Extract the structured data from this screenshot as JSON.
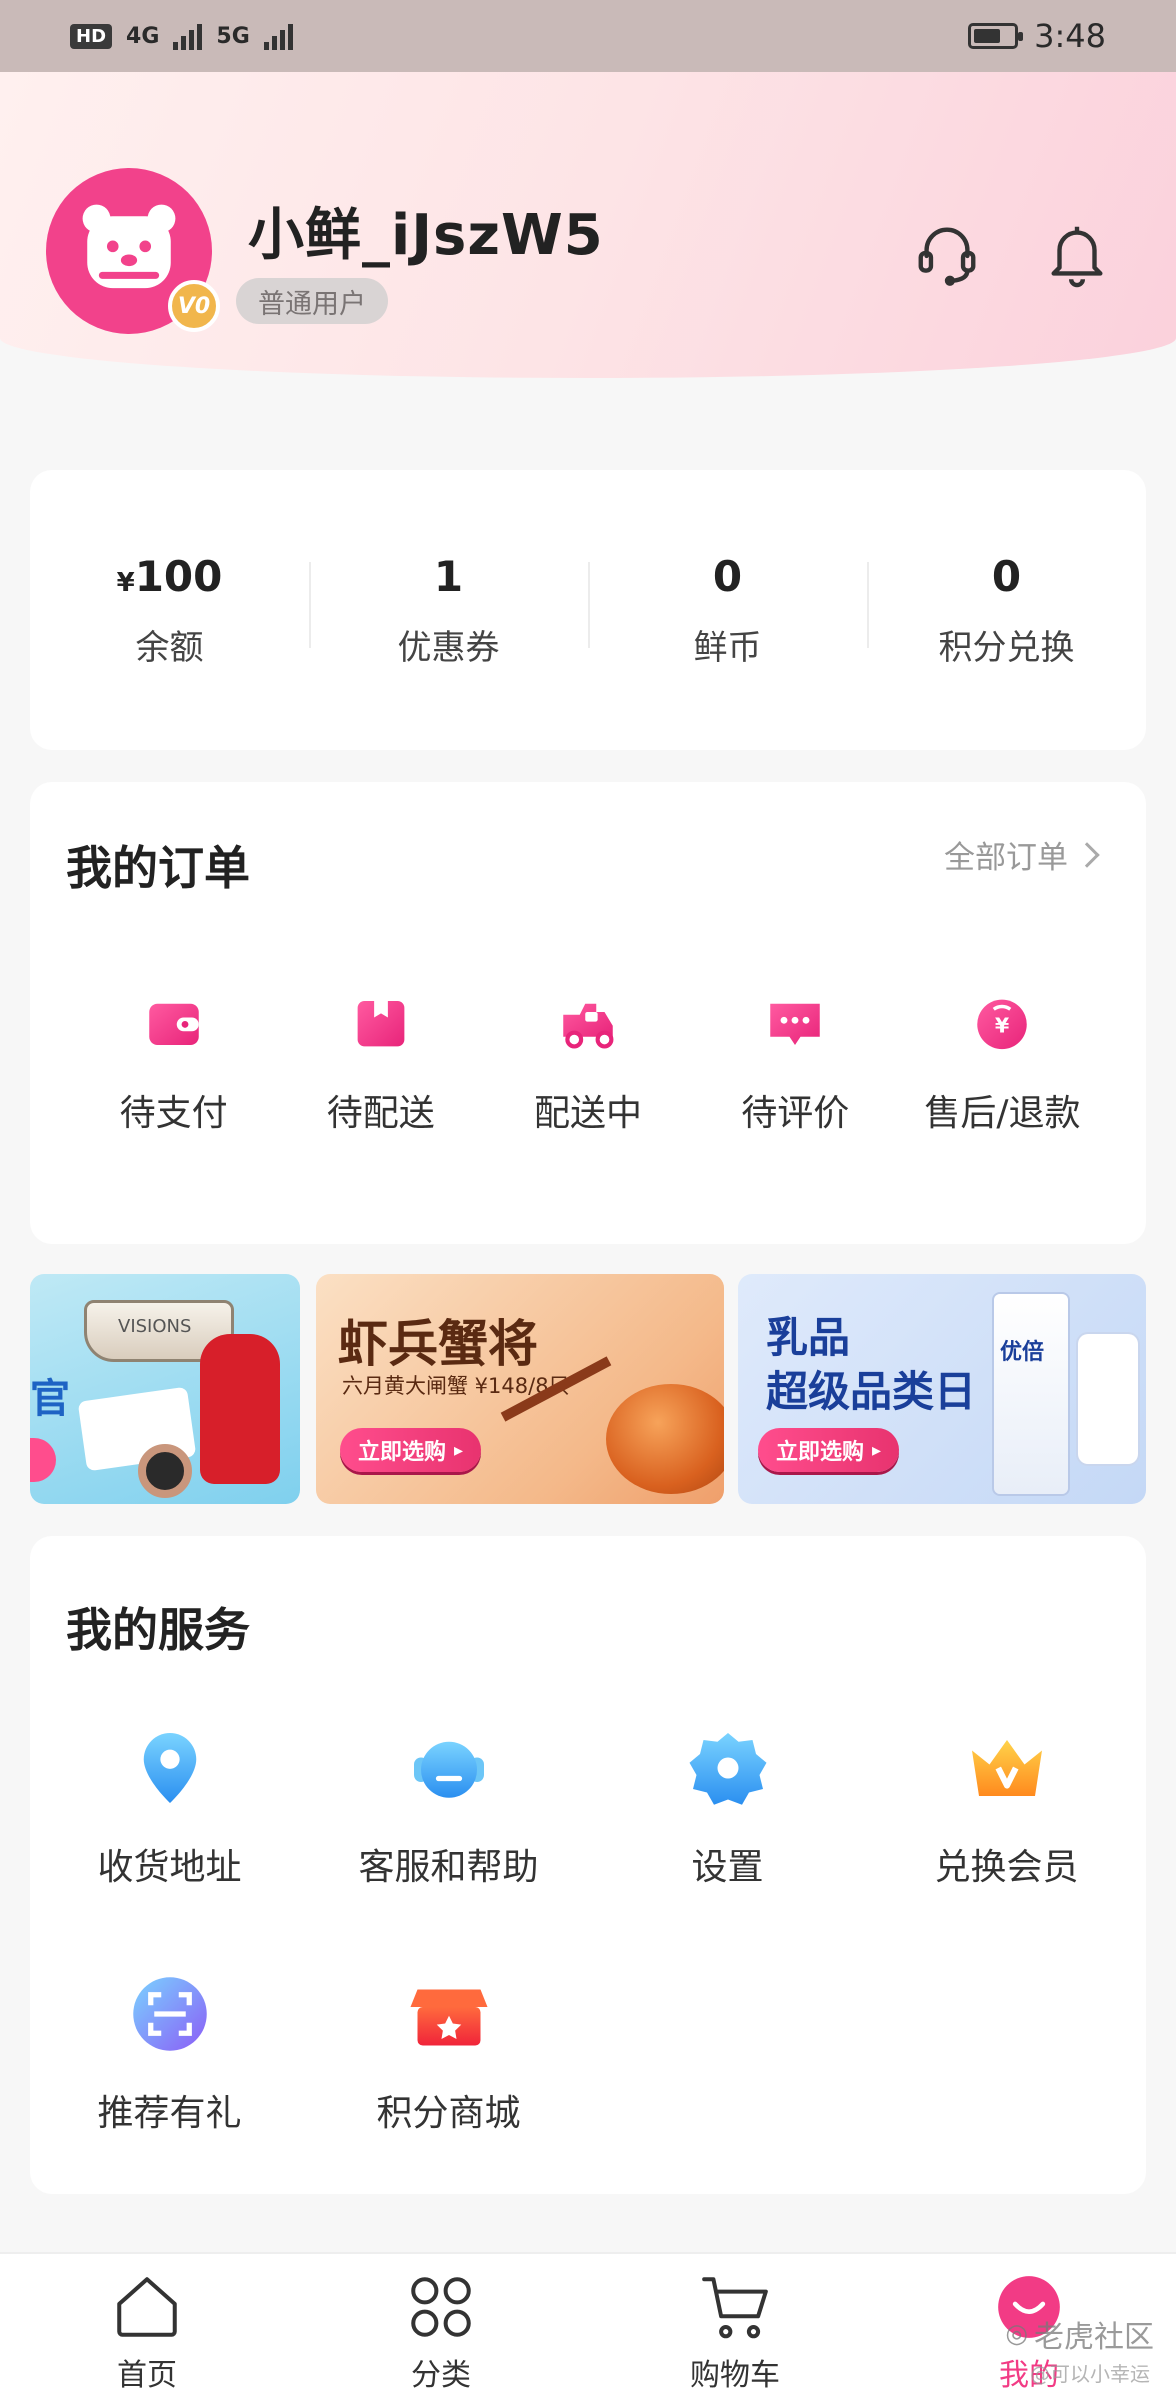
{
  "status_bar": {
    "hd": "HD",
    "net1": "4G",
    "net2": "5G",
    "time": "3:48"
  },
  "profile": {
    "username": "小鲜_iJszW5",
    "level": "普通用户",
    "vip_badge": "V0",
    "colors": {
      "accent": "#f2428b",
      "badge": "#f1b64c"
    }
  },
  "header_icons": [
    "headset-icon",
    "bell-icon"
  ],
  "stats": [
    {
      "currency": "¥",
      "value": "100",
      "label": "余额"
    },
    {
      "currency": "",
      "value": "1",
      "label": "优惠券"
    },
    {
      "currency": "",
      "value": "0",
      "label": "鲜币"
    },
    {
      "currency": "",
      "value": "0",
      "label": "积分兑换"
    }
  ],
  "orders": {
    "title": "我的订单",
    "all_label": "全部订单",
    "items": [
      {
        "label": "待支付",
        "icon": "wallet-icon"
      },
      {
        "label": "待配送",
        "icon": "package-icon"
      },
      {
        "label": "配送中",
        "icon": "delivery-scooter-icon"
      },
      {
        "label": "待评价",
        "icon": "comment-icon"
      },
      {
        "label": "售后/退款",
        "icon": "refund-icon"
      }
    ]
  },
  "banners": [
    {
      "text": "官",
      "product": "VISIONS"
    },
    {
      "title": "虾兵蟹将",
      "subtitle": "六月黄大闸蟹 ¥148/8只",
      "button": "立即选购"
    },
    {
      "title_line1": "乳品",
      "title_line2": "超级品类日",
      "button": "立即选购",
      "product": "优倍"
    }
  ],
  "services": {
    "title": "我的服务",
    "items": [
      {
        "label": "收货地址",
        "icon": "location-pin-icon"
      },
      {
        "label": "客服和帮助",
        "icon": "customer-service-icon"
      },
      {
        "label": "设置",
        "icon": "gear-icon"
      },
      {
        "label": "兑换会员",
        "icon": "crown-icon"
      },
      {
        "label": "推荐有礼",
        "icon": "scan-icon"
      },
      {
        "label": "积分商城",
        "icon": "store-icon"
      }
    ]
  },
  "bottom_nav": [
    {
      "label": "首页",
      "icon": "home-icon",
      "active": false
    },
    {
      "label": "分类",
      "icon": "grid-icon",
      "active": false
    },
    {
      "label": "购物车",
      "icon": "cart-icon",
      "active": false
    },
    {
      "label": "我的",
      "icon": "profile-icon",
      "active": true
    }
  ],
  "watermark": {
    "brand": "老虎社区",
    "sub": "@可以小幸运"
  }
}
